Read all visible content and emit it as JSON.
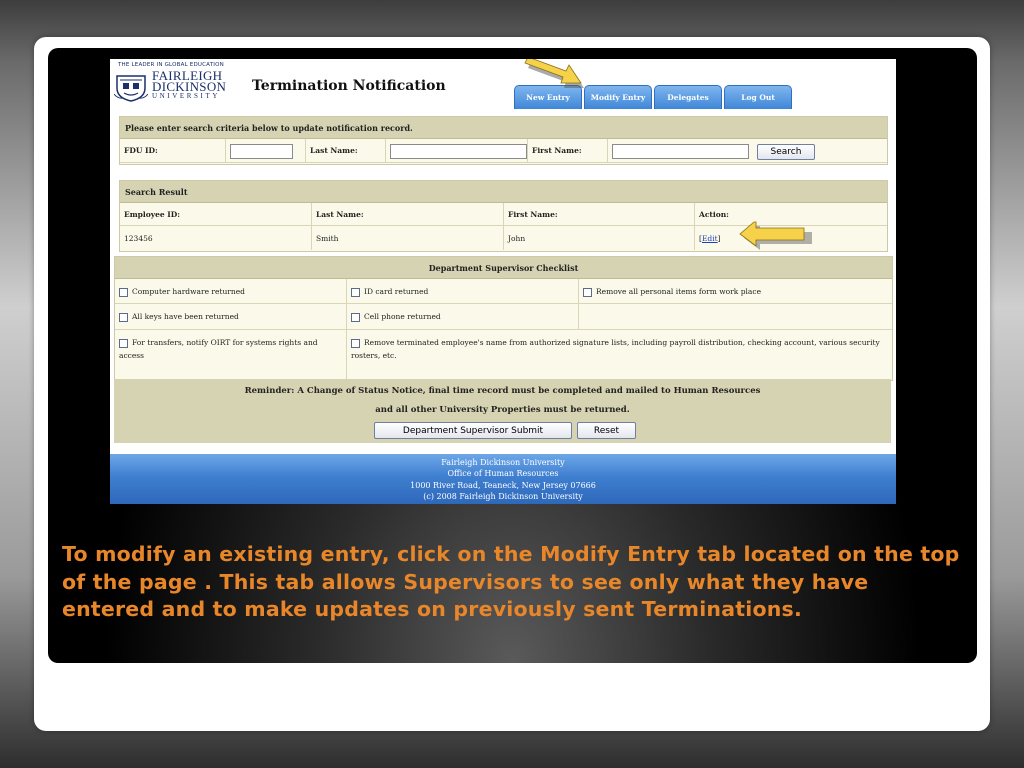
{
  "header": {
    "tagline": "THE LEADER IN GLOBAL EDUCATION",
    "logo_line1": "FAIRLEIGH",
    "logo_line2": "DICKINSON",
    "logo_line3": "UNIVERSITY",
    "app_title": "Termination Notification"
  },
  "tabs": [
    {
      "label": "New Entry"
    },
    {
      "label": "Modify Entry"
    },
    {
      "label": "Delegates"
    },
    {
      "label": "Log Out"
    }
  ],
  "search": {
    "heading": "Please enter search criteria below to update notification record.",
    "fdu_id_label": "FDU ID:",
    "last_name_label": "Last Name:",
    "first_name_label": "First Name:",
    "fdu_id_value": "",
    "last_name_value": "",
    "first_name_value": "",
    "search_button": "Search"
  },
  "results": {
    "heading": "Search Result",
    "columns": [
      "Employee ID:",
      "Last Name:",
      "First Name:",
      "Action:"
    ],
    "rows": [
      {
        "employee_id": "123456",
        "last_name": "Smith",
        "first_name": "John",
        "action": "Edit"
      }
    ]
  },
  "checklist": {
    "heading": "Department Supervisor Checklist",
    "items": [
      "Computer hardware returned",
      "ID card returned",
      "Remove all personal items form work place",
      "All keys have been returned",
      "Cell phone returned",
      "For transfers, notify OIRT for systems rights and access",
      "Remove terminated employee's name from authorized signature lists, including payroll distribution, checking account, various security rosters, etc."
    ]
  },
  "reminder": {
    "line1": "Reminder: A Change of Status Notice, final time record must be completed and mailed to Human Resources",
    "line2": "and all other University Properties must be returned.",
    "submit_button": "Department Supervisor Submit",
    "reset_button": "Reset"
  },
  "footer": {
    "line1": "Fairleigh Dickinson University",
    "line2": "Office of Human Resources",
    "line3": "1000 River Road, Teaneck, New Jersey 07666",
    "line4": "(c) 2008 Fairleigh Dickinson University"
  },
  "caption": "To modify an existing entry, click on the Modify Entry tab located on the top of the page . This tab allows Supervisors to see only what they have entered and to make updates on previously sent Terminations.",
  "colors": {
    "caption": "#e8862a",
    "tab_blue": "#3f86d8",
    "panel_header": "#d6d3b3",
    "arrow_yellow": "#f5d24a",
    "link": "#1a3fbf"
  }
}
